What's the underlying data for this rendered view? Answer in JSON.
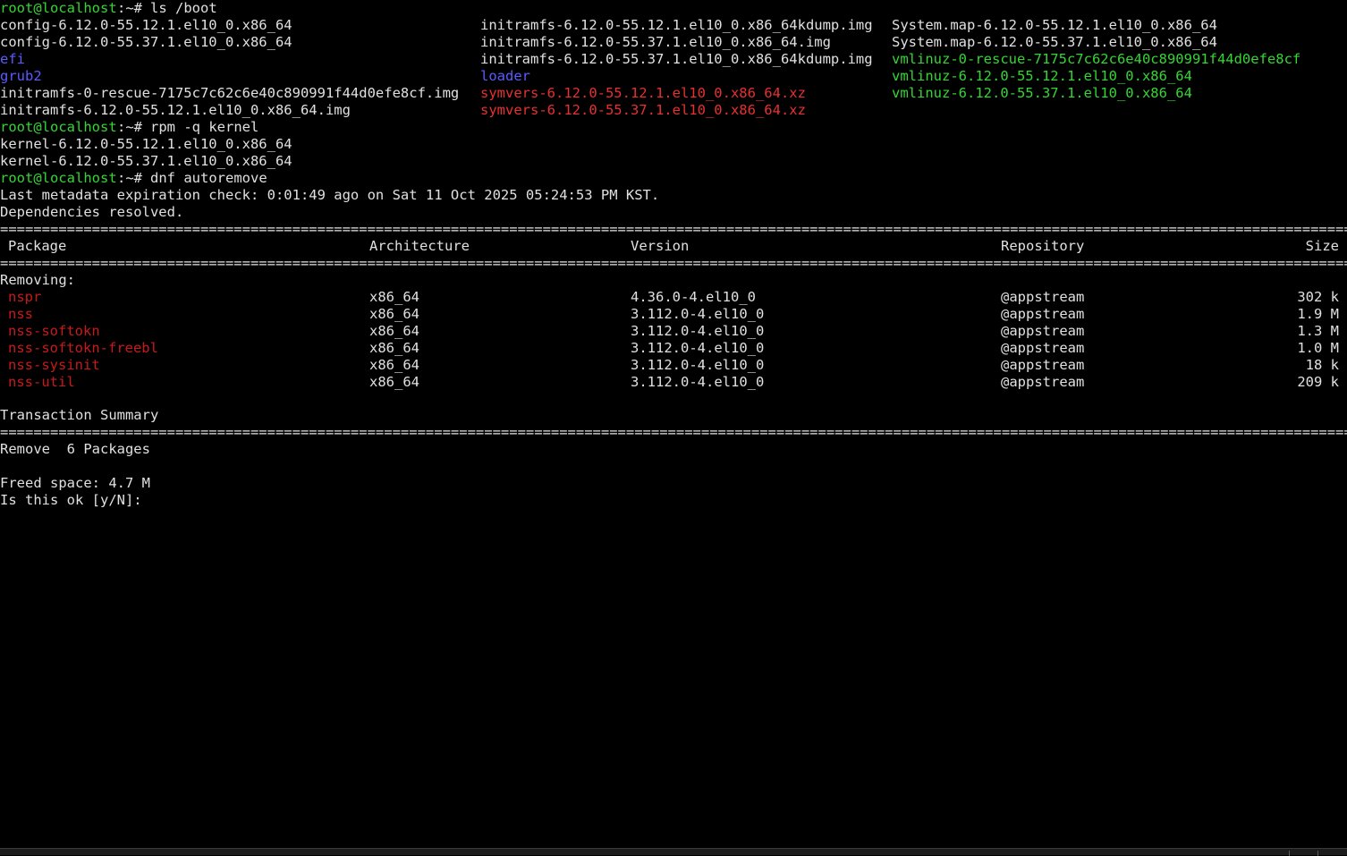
{
  "prompt_user": "root@localhost",
  "prompt_tail": ":~# ",
  "commands": {
    "ls": "ls /boot",
    "rpm": "rpm -q kernel",
    "dnf": "dnf autoremove"
  },
  "colors": {
    "prompt": "#34d634",
    "directory": "#5b5bff",
    "archive": "#e83030",
    "executable": "#34d634",
    "package_removed": "#c81a1a",
    "text": "#e0e0e0",
    "background": "#000000"
  },
  "ls_output": {
    "col1": [
      {
        "name": "config-6.12.0-55.12.1.el10_0.x86_64",
        "kind": "file"
      },
      {
        "name": "config-6.12.0-55.37.1.el10_0.x86_64",
        "kind": "file"
      },
      {
        "name": "efi",
        "kind": "dir"
      },
      {
        "name": "grub2",
        "kind": "dir"
      },
      {
        "name": "initramfs-0-rescue-7175c7c62c6e40c890991f44d0efe8cf.img",
        "kind": "file"
      },
      {
        "name": "initramfs-6.12.0-55.12.1.el10_0.x86_64.img",
        "kind": "file"
      }
    ],
    "col2": [
      {
        "name": "initramfs-6.12.0-55.12.1.el10_0.x86_64kdump.img",
        "kind": "file"
      },
      {
        "name": "initramfs-6.12.0-55.37.1.el10_0.x86_64.img",
        "kind": "file"
      },
      {
        "name": "initramfs-6.12.0-55.37.1.el10_0.x86_64kdump.img",
        "kind": "file"
      },
      {
        "name": "loader",
        "kind": "dir"
      },
      {
        "name": "symvers-6.12.0-55.12.1.el10_0.x86_64.xz",
        "kind": "archive"
      },
      {
        "name": "symvers-6.12.0-55.37.1.el10_0.x86_64.xz",
        "kind": "archive"
      }
    ],
    "col3": [
      {
        "name": "System.map-6.12.0-55.12.1.el10_0.x86_64",
        "kind": "file"
      },
      {
        "name": "System.map-6.12.0-55.37.1.el10_0.x86_64",
        "kind": "file"
      },
      {
        "name": "vmlinuz-0-rescue-7175c7c62c6e40c890991f44d0efe8cf",
        "kind": "exec"
      },
      {
        "name": "vmlinuz-6.12.0-55.12.1.el10_0.x86_64",
        "kind": "exec"
      },
      {
        "name": "vmlinuz-6.12.0-55.37.1.el10_0.x86_64",
        "kind": "exec"
      }
    ]
  },
  "rpm_output": [
    "kernel-6.12.0-55.12.1.el10_0.x86_64",
    "kernel-6.12.0-55.37.1.el10_0.x86_64"
  ],
  "dnf": {
    "metadata_line": "Last metadata expiration check: 0:01:49 ago on Sat 11 Oct 2025 05:24:53 PM KST.",
    "deps_line": "Dependencies resolved.",
    "headers": {
      "package": "Package",
      "arch": "Architecture",
      "version": "Version",
      "repo": "Repository",
      "size": "Size"
    },
    "section_label": "Removing:",
    "packages": [
      {
        "name": "nspr",
        "arch": "x86_64",
        "version": "4.36.0-4.el10_0",
        "repo": "@appstream",
        "size": "302 k"
      },
      {
        "name": "nss",
        "arch": "x86_64",
        "version": "3.112.0-4.el10_0",
        "repo": "@appstream",
        "size": "1.9 M"
      },
      {
        "name": "nss-softokn",
        "arch": "x86_64",
        "version": "3.112.0-4.el10_0",
        "repo": "@appstream",
        "size": "1.3 M"
      },
      {
        "name": "nss-softokn-freebl",
        "arch": "x86_64",
        "version": "3.112.0-4.el10_0",
        "repo": "@appstream",
        "size": "1.0 M"
      },
      {
        "name": "nss-sysinit",
        "arch": "x86_64",
        "version": "3.112.0-4.el10_0",
        "repo": "@appstream",
        "size": "18 k"
      },
      {
        "name": "nss-util",
        "arch": "x86_64",
        "version": "3.112.0-4.el10_0",
        "repo": "@appstream",
        "size": "209 k"
      }
    ],
    "summary_label": "Transaction Summary",
    "remove_line": "Remove  6 Packages",
    "freed_line": "Freed space: 4.7 M",
    "confirm_prompt": "Is this ok [y/N]: "
  }
}
